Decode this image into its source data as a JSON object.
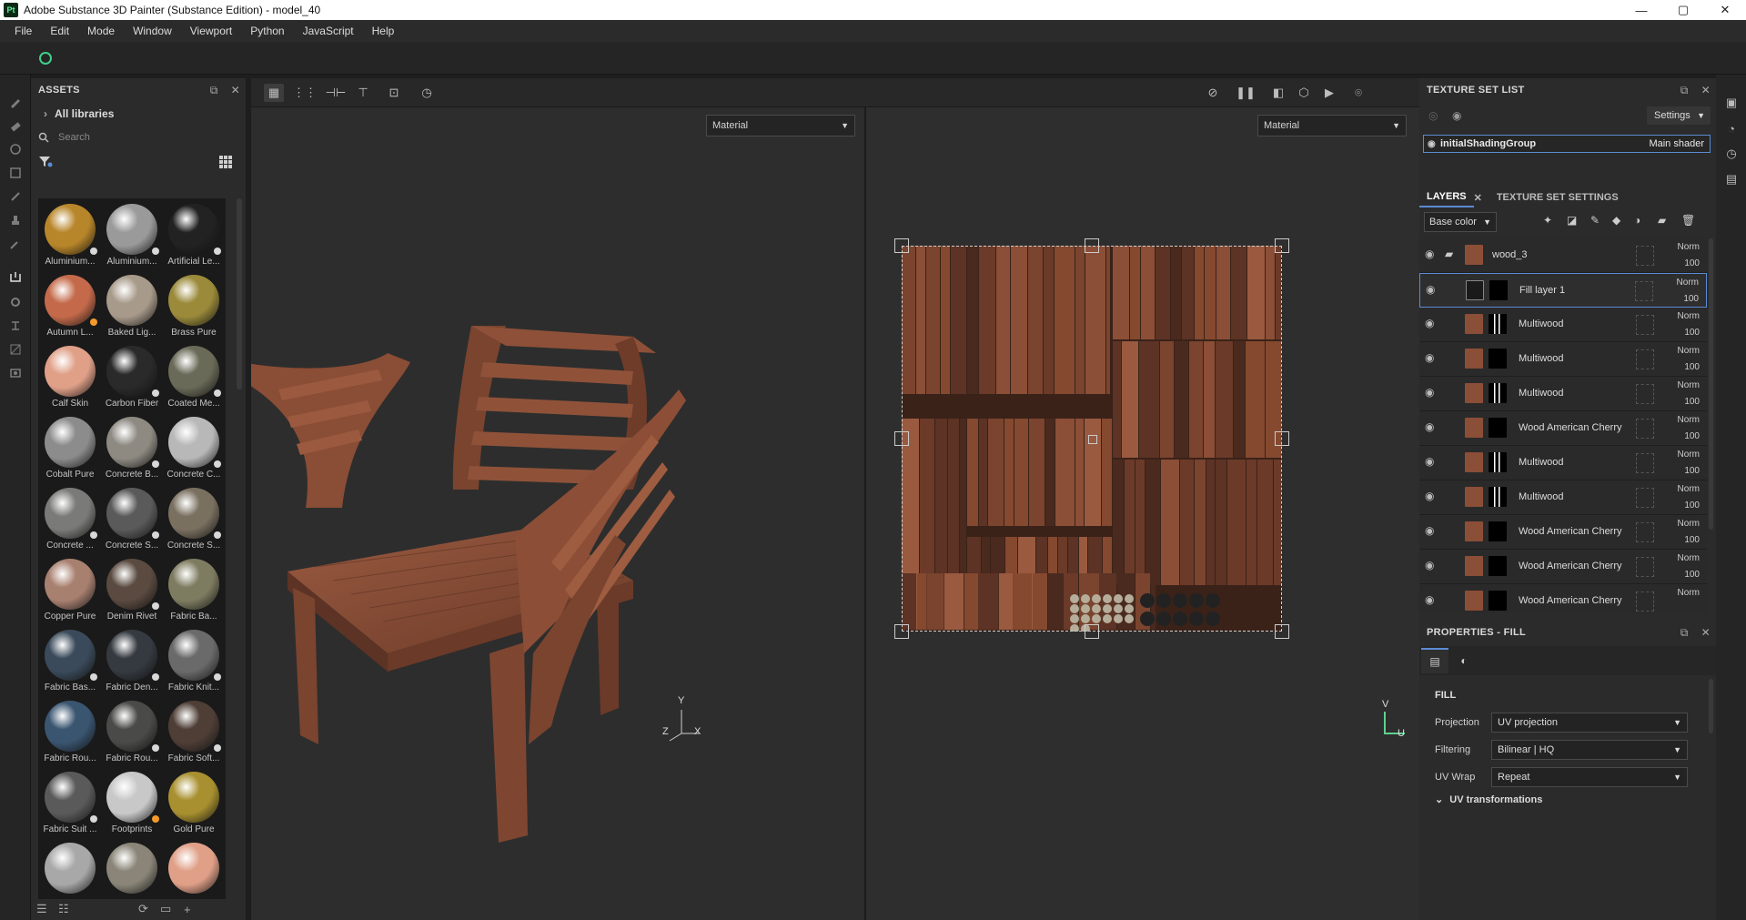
{
  "window": {
    "app_logo": "Pt",
    "title": "Adobe Substance 3D Painter (Substance Edition) - model_40",
    "controls": [
      "—",
      "▢",
      "✕"
    ]
  },
  "menu": [
    "File",
    "Edit",
    "Mode",
    "Window",
    "Viewport",
    "Python",
    "JavaScript",
    "Help"
  ],
  "assets": {
    "title": "ASSETS",
    "libraries": "All libraries",
    "search_placeholder": "Search",
    "materials": [
      {
        "label": "Aluminium...",
        "color": "#b8862a",
        "tag": "white"
      },
      {
        "label": "Aluminium...",
        "color": "#9a9a9a",
        "tag": "white"
      },
      {
        "label": "Artificial Le...",
        "color": "#222222",
        "tag": "white"
      },
      {
        "label": "Autumn L...",
        "color": "#c46a4a",
        "tag": "orange"
      },
      {
        "label": "Baked Lig...",
        "color": "#a89a8a",
        "tag": ""
      },
      {
        "label": "Brass Pure",
        "color": "#9a8a3a",
        "tag": ""
      },
      {
        "label": "Calf Skin",
        "color": "#e0a088",
        "tag": ""
      },
      {
        "label": "Carbon Fiber",
        "color": "#2a2a2a",
        "tag": "white"
      },
      {
        "label": "Coated Me...",
        "color": "#6a6a58",
        "tag": "white"
      },
      {
        "label": "Cobalt Pure",
        "color": "#8c8c8c",
        "tag": ""
      },
      {
        "label": "Concrete B...",
        "color": "#8e8a82",
        "tag": "white"
      },
      {
        "label": "Concrete C...",
        "color": "#b8b8b8",
        "tag": "white"
      },
      {
        "label": "Concrete ...",
        "color": "#7a7a78",
        "tag": "white"
      },
      {
        "label": "Concrete S...",
        "color": "#5a5a5a",
        "tag": "white"
      },
      {
        "label": "Concrete S...",
        "color": "#7a7060",
        "tag": "white"
      },
      {
        "label": "Copper Pure",
        "color": "#a88070",
        "tag": ""
      },
      {
        "label": "Denim Rivet",
        "color": "#5a4a40",
        "tag": "white"
      },
      {
        "label": "Fabric Ba...",
        "color": "#7e7c60",
        "tag": ""
      },
      {
        "label": "Fabric Bas...",
        "color": "#3a4a5a",
        "tag": "white"
      },
      {
        "label": "Fabric Den...",
        "color": "#353a40",
        "tag": "white"
      },
      {
        "label": "Fabric Knit...",
        "color": "#6a6a6a",
        "tag": "white"
      },
      {
        "label": "Fabric Rou...",
        "color": "#3a5570",
        "tag": ""
      },
      {
        "label": "Fabric Rou...",
        "color": "#4a4a48",
        "tag": "white"
      },
      {
        "label": "Fabric Soft...",
        "color": "#4e3e36",
        "tag": "white"
      },
      {
        "label": "Fabric Suit ...",
        "color": "#5a5a5a",
        "tag": "white"
      },
      {
        "label": "Footprints",
        "color": "#c8c8c8",
        "tag": "orange"
      },
      {
        "label": "Gold Pure",
        "color": "#a89030",
        "tag": ""
      },
      {
        "label": "",
        "color": "#a8a8a8",
        "tag": ""
      },
      {
        "label": "",
        "color": "#8a8578",
        "tag": ""
      },
      {
        "label": "",
        "color": "#e0a088",
        "tag": ""
      }
    ]
  },
  "viewport": {
    "left_channel": "Material",
    "right_channel": "Material",
    "gizmo3d": {
      "x": "X",
      "y": "Y",
      "z": "Z"
    },
    "gizmo2d": {
      "u": "U",
      "v": "V"
    }
  },
  "texture_set_list": {
    "title": "TEXTURE SET LIST",
    "settings": "Settings",
    "item": "initialShadingGroup",
    "shader": "Main shader"
  },
  "layers_panel": {
    "tabs": [
      "LAYERS",
      "TEXTURE SET SETTINGS"
    ],
    "channel": "Base color",
    "layers": [
      {
        "name": "wood_3",
        "blend": "Norm",
        "opacity": "100",
        "selected": false,
        "folder": true,
        "mask": "none"
      },
      {
        "name": "Fill layer 1",
        "blend": "Norm",
        "opacity": "100",
        "selected": true,
        "folder": false,
        "mask": "black"
      },
      {
        "name": "Multiwood",
        "blend": "Norm",
        "opacity": "100",
        "selected": false,
        "folder": false,
        "mask": "bars"
      },
      {
        "name": "Multiwood",
        "blend": "Norm",
        "opacity": "100",
        "selected": false,
        "folder": false,
        "mask": "black"
      },
      {
        "name": "Multiwood",
        "blend": "Norm",
        "opacity": "100",
        "selected": false,
        "folder": false,
        "mask": "bars"
      },
      {
        "name": "Wood American Cherry",
        "blend": "Norm",
        "opacity": "100",
        "selected": false,
        "folder": false,
        "mask": "black"
      },
      {
        "name": "Multiwood",
        "blend": "Norm",
        "opacity": "100",
        "selected": false,
        "folder": false,
        "mask": "bars"
      },
      {
        "name": "Multiwood",
        "blend": "Norm",
        "opacity": "100",
        "selected": false,
        "folder": false,
        "mask": "bars"
      },
      {
        "name": "Wood American Cherry",
        "blend": "Norm",
        "opacity": "100",
        "selected": false,
        "folder": false,
        "mask": "black"
      },
      {
        "name": "Wood American Cherry",
        "blend": "Norm",
        "opacity": "100",
        "selected": false,
        "folder": false,
        "mask": "black"
      },
      {
        "name": "Wood American Cherry",
        "blend": "Norm",
        "opacity": "",
        "selected": false,
        "folder": false,
        "mask": "black"
      }
    ]
  },
  "properties": {
    "title": "PROPERTIES - FILL",
    "section": "FILL",
    "projection_label": "Projection",
    "projection": "UV projection",
    "filtering_label": "Filtering",
    "filtering": "Bilinear | HQ",
    "uvwrap_label": "UV Wrap",
    "uvwrap": "Repeat",
    "uv_transformations": "UV transformations"
  },
  "colors": {
    "accent": "#5b8bd3",
    "wood": "#8b4e36",
    "wood_dark": "#5c3324"
  }
}
